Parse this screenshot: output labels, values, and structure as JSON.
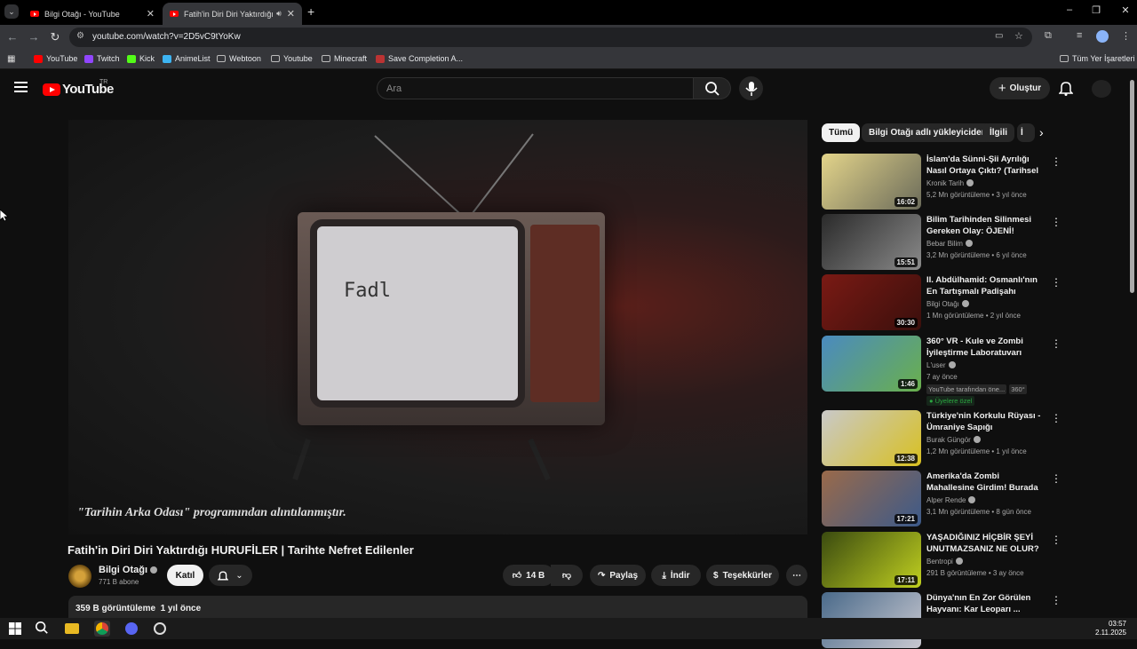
{
  "browser": {
    "tabs": [
      {
        "title": "Bilgi Otağı - YouTube",
        "active": false
      },
      {
        "title": "Fatih'in Diri Diri Yaktırdığı H",
        "active": true
      }
    ],
    "url": "youtube.com/watch?v=2D5vC9tYoKw",
    "bookmarks": [
      "YouTube",
      "Twitch",
      "Kick",
      "AnimeList",
      "Webtoon",
      "Youtube",
      "Minecraft",
      "Save Completion A..."
    ],
    "all_bookmarks": "Tüm Yer İşaretleri"
  },
  "youtube": {
    "logo_word": "YouTube",
    "region": "TR",
    "search_placeholder": "Ara",
    "create_label": "Oluştur"
  },
  "video": {
    "caption": "\"Tarihin Arka Odası\" programından alıntılanmıştır.",
    "title": "Fatih'in Diri Diri Yaktırdığı HURUFİLER | Tarihte Nefret Edilenler",
    "channel": "Bilgi Otağı",
    "subscribers": "771 B abone",
    "join_label": "Katıl",
    "likes": "14 B",
    "share_label": "Paylaş",
    "download_label": "İndir",
    "thanks_label": "Teşekkürler",
    "views": "359 B görüntüleme",
    "date": "1 yıl önce",
    "screen_text": "Fadl"
  },
  "chips": [
    "Tümü",
    "Bilgi Otağı adlı yükleyiciden",
    "İlgili",
    "İ"
  ],
  "recommendations": [
    {
      "title": "İslam'da Sünni-Şii Ayrılığı Nasıl Ortaya Çıktı? (Tarihsel Süreç) -...",
      "channel": "Kronik Tarih",
      "meta": "5,2 Mn görüntüleme • 3 yıl önce",
      "duration": "16:02",
      "thumb": "#e3d48a",
      "thumb2": "#6b6b5a"
    },
    {
      "title": "Bilim Tarihinden Silinmesi Gereken Olay: ÖJENİ!",
      "channel": "Bebar Bilim",
      "meta": "3,2 Mn görüntüleme • 6 yıl önce",
      "duration": "15:51",
      "thumb": "#2a2a2a",
      "thumb2": "#8a8a8a"
    },
    {
      "title": "II. Abdülhamid: Osmanlı'nın En Tartışmalı Padişahı",
      "channel": "Bilgi Otağı",
      "meta": "1 Mn görüntüleme • 2 yıl önce",
      "duration": "30:30",
      "thumb": "#7a1a14",
      "thumb2": "#3a0f0c"
    },
    {
      "title": "360° VR - Kule ve Zombi İyileştirme Laboratuvarı",
      "channel": "L'user",
      "meta": "7 ay önce",
      "duration": "1:46",
      "thumb": "#4a8ac0",
      "thumb2": "#6ab04c",
      "badge1": "YouTube tarafından öne...",
      "badge2": "360°",
      "members": "Üyelere özel"
    },
    {
      "title": "Türkiye'nin Korkulu Rüyası - Ümraniye Sapığı",
      "channel": "Burak Güngör",
      "meta": "1,2 Mn görüntüleme • 1 yıl önce",
      "duration": "12:38",
      "thumb": "#c9c9c9",
      "thumb2": "#d8c020"
    },
    {
      "title": "Amerika'da Zombi Mahallesine Girdim! Burada Her Şey Yasal! ...",
      "channel": "Alper Rende",
      "meta": "3,1 Mn görüntüleme • 8 gün önce",
      "duration": "17:21",
      "thumb": "#9a6a4a",
      "thumb2": "#3c5a8a"
    },
    {
      "title": "YAŞADIĞINIZ HİÇBİR ŞEYİ UNUTMAZSANIZ NE OLUR?",
      "channel": "Bentropi",
      "meta": "291 B görüntüleme • 3 ay önce",
      "duration": "17:11",
      "thumb": "#3a4a10",
      "thumb2": "#c0d020"
    },
    {
      "title": "Dünya'nın En Zor Görülen Hayvanı: Kar Leoparı ...",
      "channel": "",
      "meta": "",
      "duration": "",
      "thumb": "#4a6a8a",
      "thumb2": "#c8c8d0"
    }
  ],
  "taskbar": {
    "time": "03:57",
    "date": "2.11.2025"
  },
  "colors": {
    "accent": "#ff0000",
    "bg": "#0f0f0f",
    "surface": "#272727",
    "verified": "#aaaaaa",
    "members": "#2ba640"
  }
}
